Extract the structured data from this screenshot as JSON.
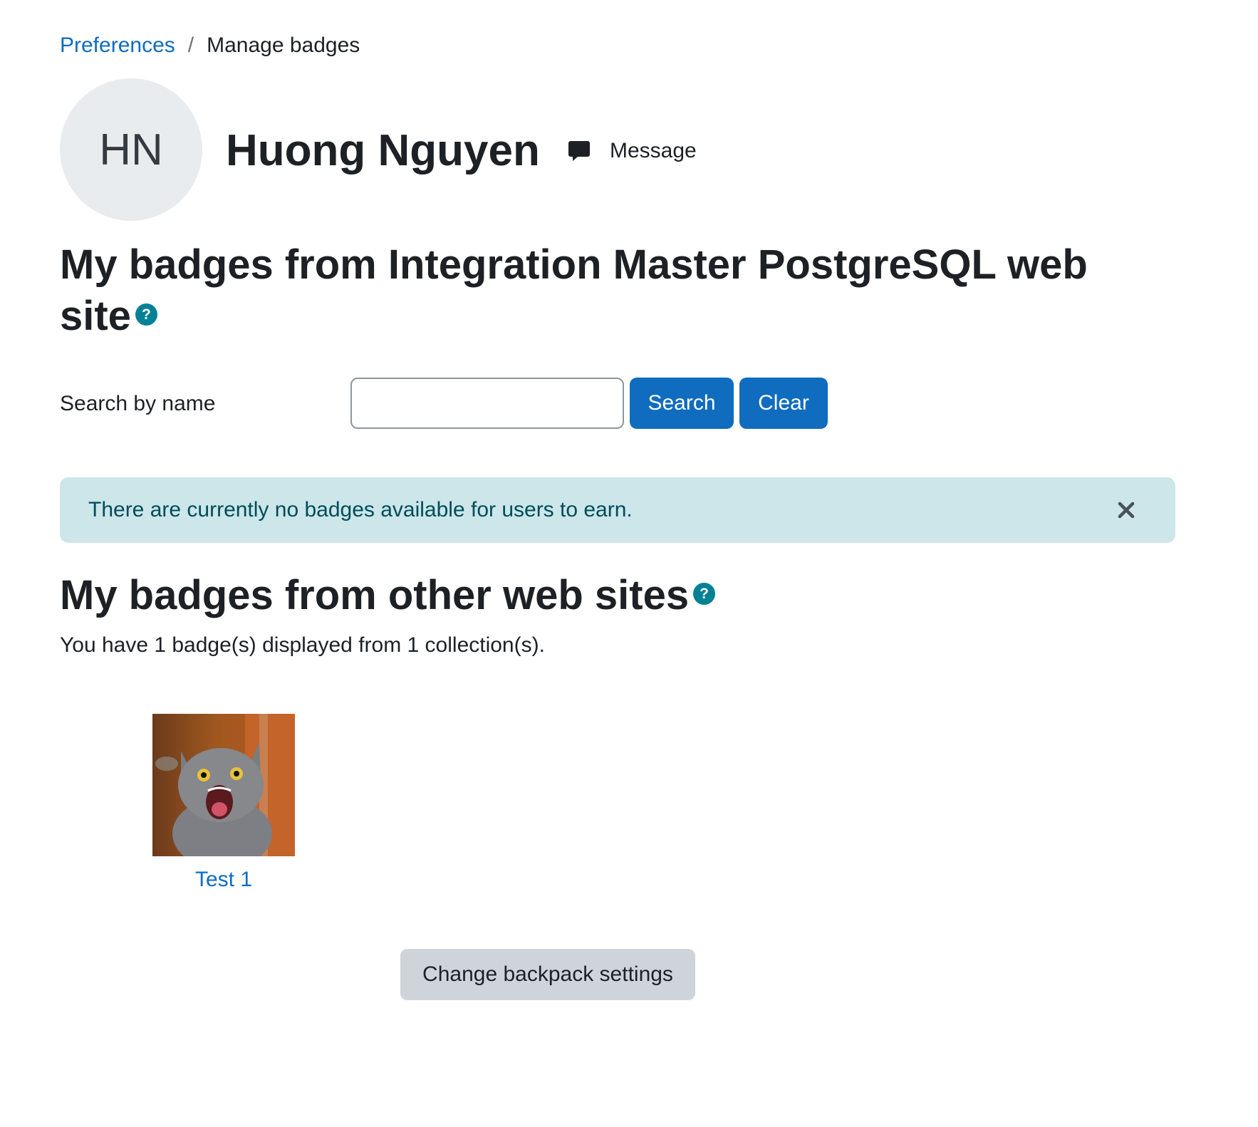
{
  "breadcrumb": {
    "parent": "Preferences",
    "separator": "/",
    "current": "Manage badges"
  },
  "user": {
    "initials": "HN",
    "name": "Huong Nguyen",
    "message_label": "Message"
  },
  "site_badges": {
    "heading": "My badges from Integration Master PostgreSQL web site",
    "help_icon": "?",
    "search_label": "Search by name",
    "search_value": "",
    "search_button": "Search",
    "clear_button": "Clear",
    "alert_text": "There are currently no badges available for users to earn."
  },
  "external_badges": {
    "heading": "My badges from other web sites",
    "help_icon": "?",
    "summary": "You have 1 badge(s) displayed from 1 collection(s).",
    "badges": [
      {
        "name": "Test 1"
      }
    ],
    "backpack_button": "Change backpack settings"
  },
  "colors": {
    "primary": "#0f6cbf",
    "info_bg": "#cce6ea",
    "info_text": "#004c59",
    "help_icon": "#008196",
    "secondary_bg": "#ced4da"
  }
}
